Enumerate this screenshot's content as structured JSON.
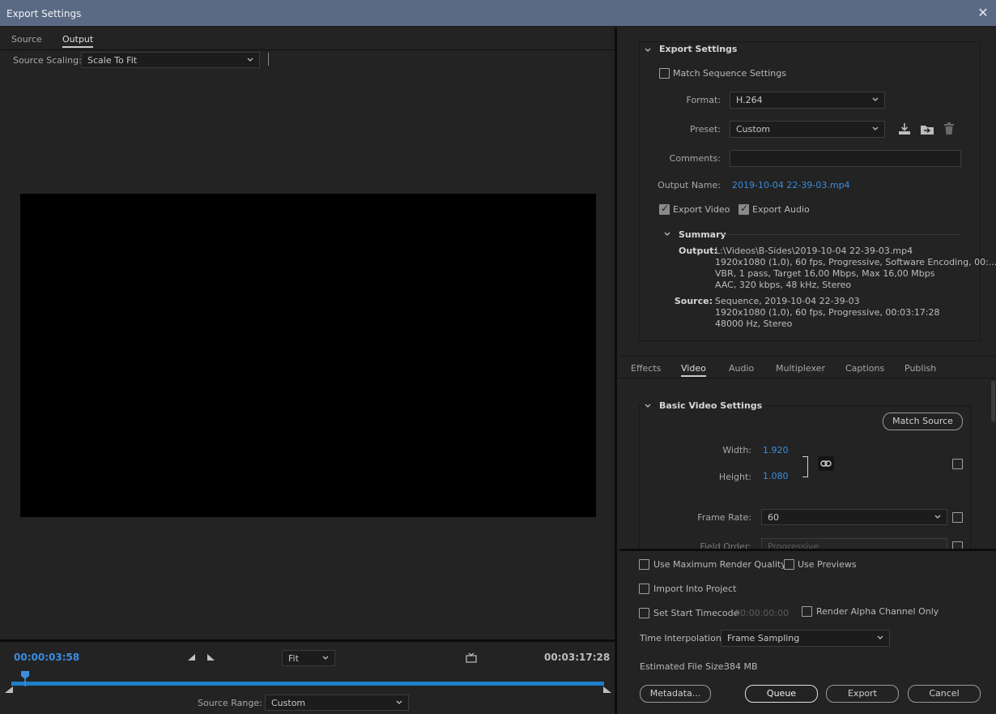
{
  "window": {
    "title": "Export Settings",
    "close_glyph": "✕"
  },
  "left": {
    "tabs": [
      {
        "label": "Source"
      },
      {
        "label": "Output"
      }
    ],
    "source_scaling": {
      "label": "Source Scaling:",
      "value": "Scale To Fit"
    },
    "current_time": "00:00:03:58",
    "end_time": "00:03:17:28",
    "zoom": "Fit",
    "source_range": {
      "label": "Source Range:",
      "value": "Custom"
    },
    "playhead_position": 0.02
  },
  "export": {
    "section_title": "Export Settings",
    "match_sequence": {
      "label": "Match Sequence Settings",
      "checked": false
    },
    "format": {
      "label": "Format:",
      "value": "H.264"
    },
    "preset": {
      "label": "Preset:",
      "value": "Custom"
    },
    "comments": {
      "label": "Comments:",
      "value": ""
    },
    "output_name": {
      "label": "Output Name:",
      "value": "2019-10-04 22-39-03.mp4"
    },
    "export_video": {
      "label": "Export Video",
      "checked": true
    },
    "export_audio": {
      "label": "Export Audio",
      "checked": true
    },
    "summary": {
      "title": "Summary",
      "output_label": "Output:",
      "output_lines": [
        "L:\\Videos\\B-Sides\\2019-10-04 22-39-03.mp4",
        "1920x1080 (1,0), 60 fps, Progressive, Software Encoding, 00:...",
        "VBR, 1 pass, Target 16,00 Mbps, Max 16,00 Mbps",
        "AAC, 320 kbps, 48 kHz, Stereo"
      ],
      "source_label": "Source:",
      "source_lines": [
        "Sequence, 2019-10-04 22-39-03",
        "1920x1080 (1,0), 60 fps, Progressive, 00:03:17:28",
        "48000 Hz, Stereo"
      ]
    }
  },
  "settings_tabs": [
    {
      "label": "Effects"
    },
    {
      "label": "Video"
    },
    {
      "label": "Audio"
    },
    {
      "label": "Multiplexer"
    },
    {
      "label": "Captions"
    },
    {
      "label": "Publish"
    }
  ],
  "video": {
    "section_title": "Basic Video Settings",
    "match_source": "Match Source",
    "width": {
      "label": "Width:",
      "value": "1.920"
    },
    "height": {
      "label": "Height:",
      "value": "1.080"
    },
    "frame_rate": {
      "label": "Frame Rate:",
      "value": "60"
    },
    "field_order": {
      "label": "Field Order:",
      "value": "Progressive"
    }
  },
  "bottom": {
    "max_render_quality": "Use Maximum Render Quality",
    "use_previews": "Use Previews",
    "import_into_project": "Import Into Project",
    "set_start_timecode": "Set Start Timecode",
    "start_timecode_value": "00:00:00:00",
    "render_alpha": "Render Alpha Channel Only",
    "time_interpolation": {
      "label": "Time Interpolation:",
      "value": "Frame Sampling"
    },
    "file_size": {
      "label": "Estimated File Size:",
      "value": "384 MB"
    },
    "buttons": {
      "metadata": "Metadata...",
      "queue": "Queue",
      "export": "Export",
      "cancel": "Cancel"
    }
  },
  "colors": {
    "accent": "#3b8de0",
    "titlebar": "#5a6a85",
    "panel": "#232323"
  }
}
